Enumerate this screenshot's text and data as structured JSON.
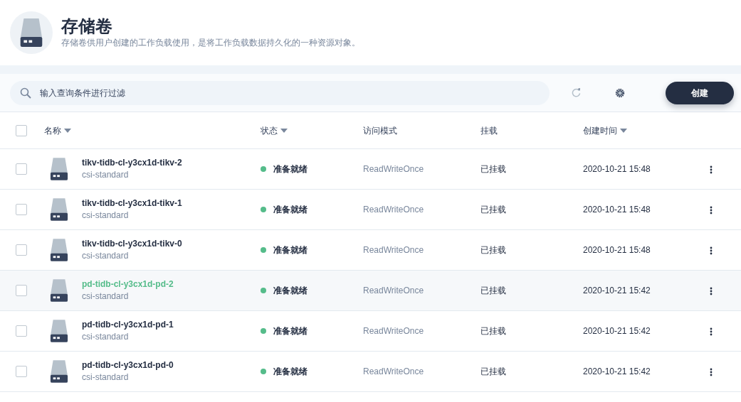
{
  "header": {
    "title": "存储卷",
    "description": "存储卷供用户创建的工作负载使用，是将工作负载数据持久化的一种资源对象。"
  },
  "toolbar": {
    "search": {
      "placeholder": "输入查询条件进行过滤"
    },
    "create_button": "创建"
  },
  "table": {
    "select_all": {
      "checked": false
    },
    "columns": [
      {
        "label": "名称",
        "sortable": true
      },
      {
        "label": "状态",
        "sortable": true
      },
      {
        "label": "访问模式",
        "sortable": false
      },
      {
        "label": "挂载",
        "sortable": false
      },
      {
        "label": "创建时间",
        "sortable": true
      }
    ],
    "rows": [
      {
        "checked": false,
        "hovered": false,
        "name": "tikv-tidb-cl-y3cx1d-tikv-2",
        "storage_class": "csi-standard",
        "status": "准备就绪",
        "access_mode": "ReadWriteOnce",
        "mount": "已挂载",
        "created": "2020-10-21 15:48"
      },
      {
        "checked": false,
        "hovered": false,
        "name": "tikv-tidb-cl-y3cx1d-tikv-1",
        "storage_class": "csi-standard",
        "status": "准备就绪",
        "access_mode": "ReadWriteOnce",
        "mount": "已挂载",
        "created": "2020-10-21 15:48"
      },
      {
        "checked": false,
        "hovered": false,
        "name": "tikv-tidb-cl-y3cx1d-tikv-0",
        "storage_class": "csi-standard",
        "status": "准备就绪",
        "access_mode": "ReadWriteOnce",
        "mount": "已挂载",
        "created": "2020-10-21 15:48"
      },
      {
        "checked": false,
        "hovered": true,
        "name": "pd-tidb-cl-y3cx1d-pd-2",
        "storage_class": "csi-standard",
        "status": "准备就绪",
        "access_mode": "ReadWriteOnce",
        "mount": "已挂载",
        "created": "2020-10-21 15:42"
      },
      {
        "checked": false,
        "hovered": false,
        "name": "pd-tidb-cl-y3cx1d-pd-1",
        "storage_class": "csi-standard",
        "status": "准备就绪",
        "access_mode": "ReadWriteOnce",
        "mount": "已挂载",
        "created": "2020-10-21 15:42"
      },
      {
        "checked": false,
        "hovered": false,
        "name": "pd-tidb-cl-y3cx1d-pd-0",
        "storage_class": "csi-standard",
        "status": "准备就绪",
        "access_mode": "ReadWriteOnce",
        "mount": "已挂载",
        "created": "2020-10-21 15:42"
      }
    ]
  }
}
